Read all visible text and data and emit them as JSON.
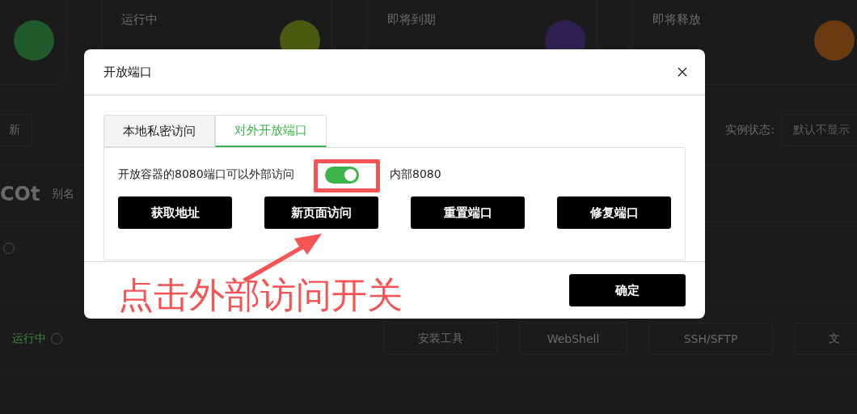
{
  "background": {
    "stat_cards": [
      {
        "color": "#1e5a2a"
      },
      {
        "label": "运行中",
        "color": "#4a5a10"
      },
      {
        "label": "即将到期",
        "color": "#2e2050"
      },
      {
        "label": "即将释放",
        "color": "#6a3a10"
      }
    ],
    "refresh_button": "新",
    "status_filter": {
      "label": "实例状态:",
      "placeholder": "默认不显示"
    },
    "instance": {
      "name": "COt",
      "alias_label": "别名",
      "status": "运行中",
      "actions": [
        "安装工具",
        "WebShell",
        "SSH/SFTP",
        "文"
      ]
    }
  },
  "modal": {
    "title": "开放端口",
    "tabs": [
      {
        "label": "本地私密访问",
        "selected": false
      },
      {
        "label": "对外开放端口",
        "selected": true
      }
    ],
    "toggle": {
      "label": "开放容器的8080端口可以外部访问",
      "on": true,
      "note": "内部8080"
    },
    "buttons": [
      "获取地址",
      "新页面访问",
      "重置端口",
      "修复端口"
    ],
    "confirm": "确定"
  },
  "annotation": {
    "text": "点击外部访问开关"
  }
}
